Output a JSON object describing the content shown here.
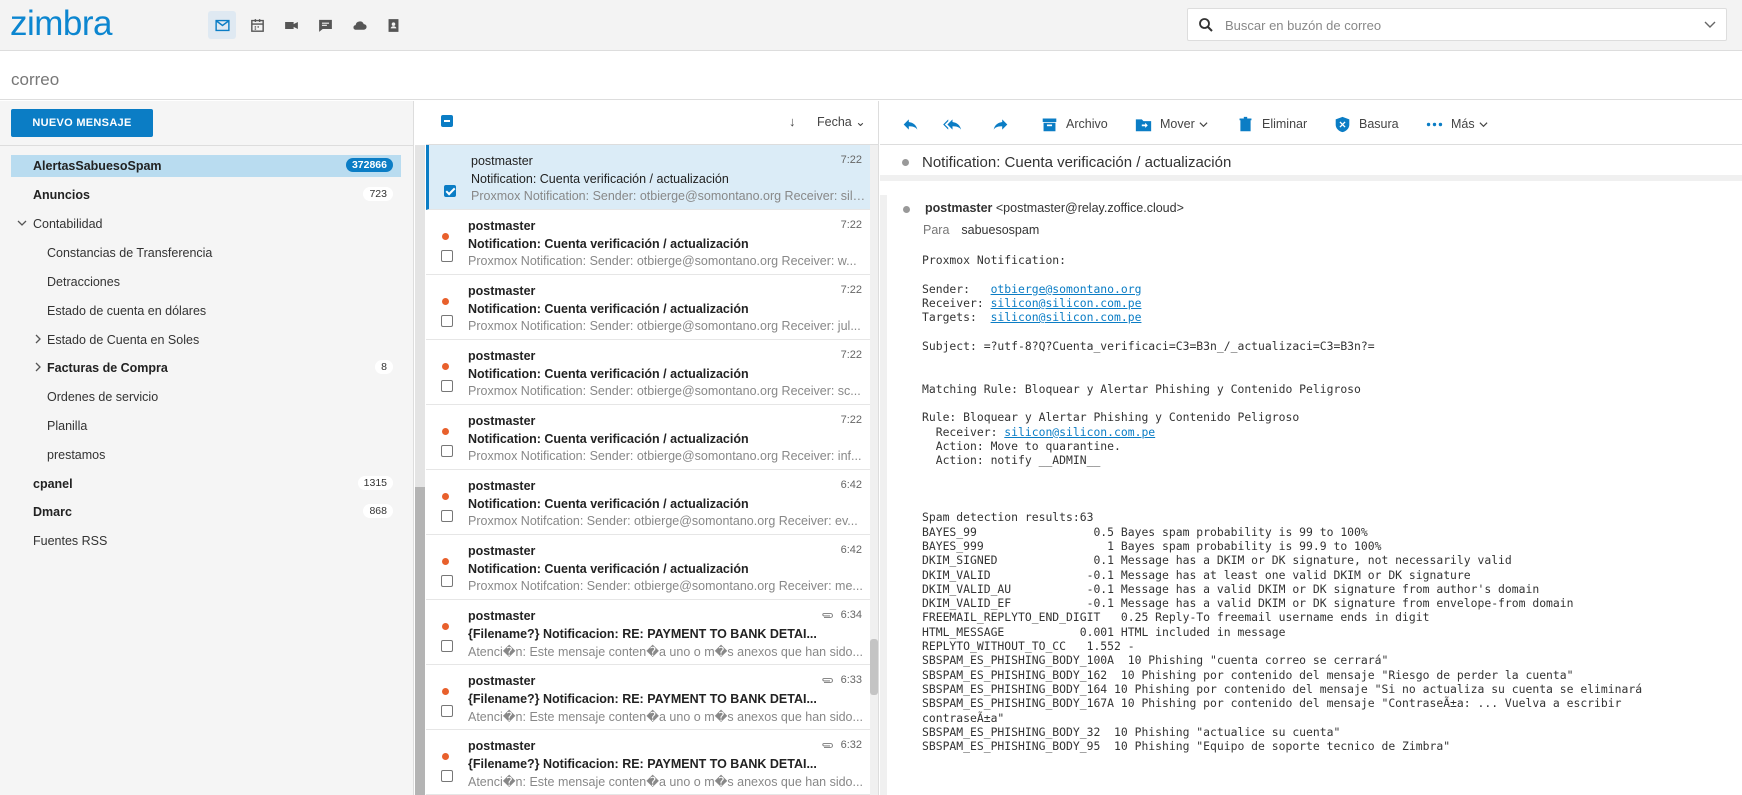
{
  "app": {
    "logo": "zimbra"
  },
  "search": {
    "placeholder": "Buscar en buzón de correo"
  },
  "mode": {
    "label": "correo"
  },
  "toolbar_left": {
    "new_message": "NUEVO MENSAJE"
  },
  "folders": [
    {
      "name": "AlertasSabuesoSpam",
      "count": "372866",
      "bold": true,
      "selected": true
    },
    {
      "name": "Anuncios",
      "count": "723",
      "bold": true
    },
    {
      "name": "Contabilidad",
      "count": "",
      "bold": false
    },
    {
      "name": "Constancias de Transferencia",
      "count": ""
    },
    {
      "name": "Detracciones",
      "count": ""
    },
    {
      "name": "Estado de cuenta en dólares",
      "count": ""
    },
    {
      "name": "Estado de Cuenta en Soles",
      "count": ""
    },
    {
      "name": "Facturas de Compra",
      "count": "8",
      "bold": true
    },
    {
      "name": "Ordenes de servicio",
      "count": ""
    },
    {
      "name": "Planilla",
      "count": ""
    },
    {
      "name": "prestamos",
      "count": ""
    },
    {
      "name": "cpanel",
      "count": "1315",
      "bold": true
    },
    {
      "name": "Dmarc",
      "count": "868",
      "bold": true
    },
    {
      "name": "Fuentes RSS",
      "count": ""
    }
  ],
  "list": {
    "sort_label": "Fecha",
    "messages": [
      {
        "from": "postmaster",
        "time": "7:22",
        "subject": "Notification: Cuenta verificación / actualización",
        "preview": "Proxmox Notification: Sender: otbierge@somontano.org Receiver: silicon@silicon.com.pe"
      },
      {
        "from": "postmaster",
        "time": "7:22",
        "subject": "Notification: Cuenta verificación / actualización",
        "preview": "Proxmox Notification: Sender: otbierge@somontano.org Receiver: w..."
      },
      {
        "from": "postmaster",
        "time": "7:22",
        "subject": "Notification: Cuenta verificación / actualización",
        "preview": "Proxmox Notification: Sender: otbierge@somontano.org Receiver: jul..."
      },
      {
        "from": "postmaster",
        "time": "7:22",
        "subject": "Notification: Cuenta verificación / actualización",
        "preview": "Proxmox Notification: Sender: otbierge@somontano.org Receiver: sc..."
      },
      {
        "from": "postmaster",
        "time": "7:22",
        "subject": "Notification: Cuenta verificación / actualización",
        "preview": "Proxmox Notification: Sender: otbierge@somontano.org Receiver: inf..."
      },
      {
        "from": "postmaster",
        "time": "6:42",
        "subject": "Notification: Cuenta verificación / actualización",
        "preview": "Proxmox Notifcation: Sender: otbierge@somontano.org Receiver: ev..."
      },
      {
        "from": "postmaster",
        "time": "6:42",
        "subject": "Notification: Cuenta verificación / actualización",
        "preview": "Proxmox Notifcation: Sender: otbierge@somontano.org Receiver: me..."
      },
      {
        "from": "postmaster",
        "time": "6:34",
        "subject": "{Filename?} Notificacion: RE: PAYMENT TO BANK DETAI...",
        "preview": "Atenci�n: Este mensaje conten�a uno o m�s anexos que han sido..."
      },
      {
        "from": "postmaster",
        "time": "6:33",
        "subject": "{Filename?} Notificacion: RE: PAYMENT TO BANK DETAI...",
        "preview": "Atenci�n: Este mensaje conten�a uno o m�s anexos que han sido..."
      },
      {
        "from": "postmaster",
        "time": "6:32",
        "subject": "{Filename?} Notificacion: RE: PAYMENT TO BANK DETAI...",
        "preview": "Atenci�n: Este mensaje conten�a uno o m�s anexos que han sido..."
      }
    ]
  },
  "reader_toolbar": {
    "archive": "Archivo",
    "move": "Mover",
    "delete": "Eliminar",
    "junk": "Basura",
    "more": "Más"
  },
  "reader": {
    "subject": "Notification: Cuenta verificación / actualización",
    "from_name": "postmaster",
    "from_addr": "<postmaster@relay.zoffice.cloud>",
    "to_label": "Para",
    "to_value": "sabuesospam",
    "body": {
      "intro": "Proxmox Notification:",
      "sender_label": "Sender:   ",
      "sender": "otbierge@somontano.org",
      "receiver_label": "Receiver: ",
      "receiver": "silicon@silicon.com.pe",
      "targets_label": "Targets:  ",
      "targets": "silicon@silicon.com.pe",
      "subject_line": "Subject: =?utf-8?Q?Cuenta_verificaci=C3=B3n_/_actualizaci=C3=B3n?=",
      "matching_rule": "Matching Rule: Bloquear y Alertar Phishing y Contenido Peligroso",
      "rule": "Rule: Bloquear y Alertar Phishing y Contenido Peligroso",
      "rule_receiver_label": "  Receiver: ",
      "rule_receiver": "silicon@silicon.com.pe",
      "action1": "  Action: Move to quarantine.",
      "action2": "  Action: notify __ADMIN__",
      "spam_lines": [
        "Spam detection results:63",
        "BAYES_99                 0.5 Bayes spam probability is 99 to 100%",
        "BAYES_999                  1 Bayes spam probability is 99.9 to 100%",
        "DKIM_SIGNED              0.1 Message has a DKIM or DK signature, not necessarily valid",
        "DKIM_VALID              -0.1 Message has at least one valid DKIM or DK signature",
        "DKIM_VALID_AU           -0.1 Message has a valid DKIM or DK signature from author's domain",
        "DKIM_VALID_EF           -0.1 Message has a valid DKIM or DK signature from envelope-from domain",
        "FREEMAIL_REPLYTO_END_DIGIT   0.25 Reply-To freemail username ends in digit",
        "HTML_MESSAGE           0.001 HTML included in message",
        "REPLYTO_WITHOUT_TO_CC   1.552 -",
        "SBSPAM_ES_PHISHING_BODY_100A  10 Phishing \"cuenta correo se cerrará\"",
        "SBSPAM_ES_PHISHING_BODY_162  10 Phishing por contenido del mensaje \"Riesgo de perder la cuenta\"",
        "SBSPAM_ES_PHISHING_BODY_164 10 Phishing por contenido del mensaje \"Si no actualiza su cuenta se eliminará",
        "SBSPAM_ES_PHISHING_BODY_167A 10 Phishing por contenido del mensaje \"ContraseÃ±a: ... Vuelva a escribir",
        "contraseÃ±a\"",
        "SBSPAM_ES_PHISHING_BODY_32  10 Phishing \"actualice su cuenta\"",
        "SBSPAM_ES_PHISHING_BODY_95  10 Phishing \"Equipo de soporte tecnico de Zimbra\""
      ]
    }
  },
  "colors": {
    "accent": "#0b7dc5",
    "unread_dot": "#e8602c",
    "selected_folder": "#b9dcf0"
  }
}
